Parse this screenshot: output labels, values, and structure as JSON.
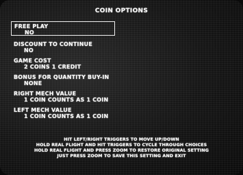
{
  "screen": {
    "title": "COIN OPTIONS"
  },
  "options": [
    {
      "label": "FREE PLAY",
      "value": "NO"
    },
    {
      "label": "DISCOUNT TO CONTINUE",
      "value": "NO"
    },
    {
      "label": "GAME COST",
      "value": "2 COINS 1 CREDIT"
    },
    {
      "label": "BONUS FOR QUANTITY BUY-IN",
      "value": "NONE"
    },
    {
      "label": "RIGHT MECH VALUE",
      "value": "1 COIN COUNTS AS 1 COIN"
    },
    {
      "label": "LEFT MECH VALUE",
      "value": "1 COIN COUNTS AS 1 COIN"
    }
  ],
  "selected_option": "FREE PLAY",
  "instructions": [
    "HIT LEFT/RIGHT TRIGGERS TO MOVE UP/DOWN",
    "HOLD REAL FLIGHT AND HIT TRIGGERS TO CYCLE THROUGH CHOICES",
    "HOLD REAL FLIGHT AND PRESS ZOOM TO RESTORE ORIGINAL SETTING",
    "JUST PRESS ZOOM TO SAVE THIS SETTING AND EXIT"
  ],
  "colors": {
    "background": "#181818",
    "text": "#f4f4f4",
    "selection_border": "#f0f0f0"
  }
}
